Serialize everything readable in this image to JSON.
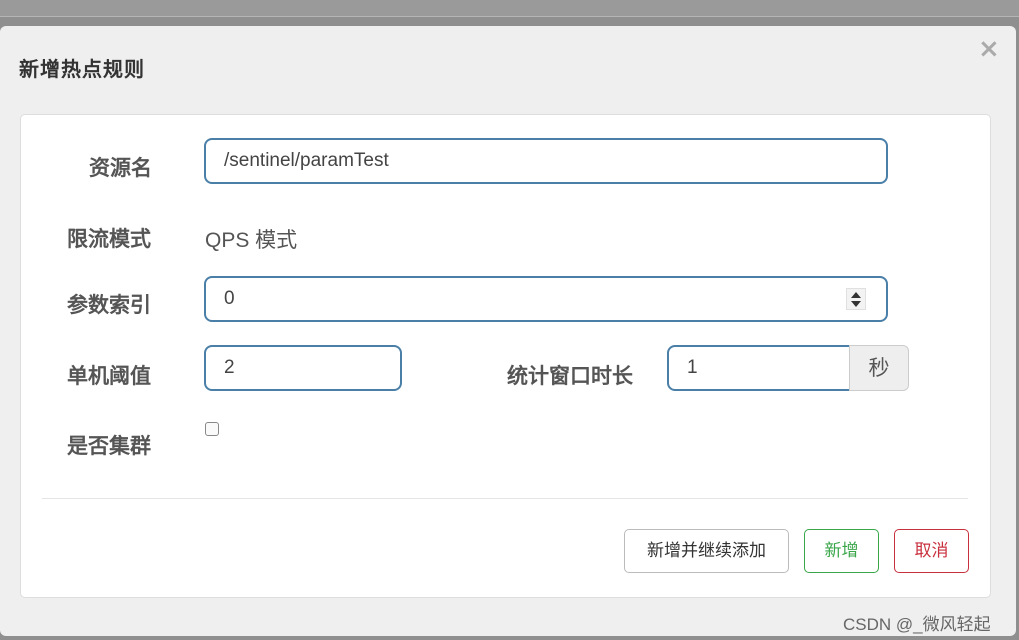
{
  "dialog": {
    "title": "新增热点规则",
    "close_glyph": "×"
  },
  "form": {
    "resource_label": "资源名",
    "resource_value": "/sentinel/paramTest",
    "mode_label": "限流模式",
    "mode_value": "QPS 模式",
    "param_index_label": "参数索引",
    "param_index_value": "0",
    "threshold_label": "单机阈值",
    "threshold_value": "2",
    "window_label": "统计窗口时长",
    "window_value": "1",
    "window_unit": "秒",
    "cluster_label": "是否集群",
    "cluster_checked": false
  },
  "buttons": {
    "add_continue": "新增并继续添加",
    "add": "新增",
    "cancel": "取消"
  },
  "watermark": "CSDN @_微风轻起",
  "colors": {
    "input_border": "#4a7fa8",
    "success": "#3aa64a",
    "danger": "#c9303e"
  }
}
